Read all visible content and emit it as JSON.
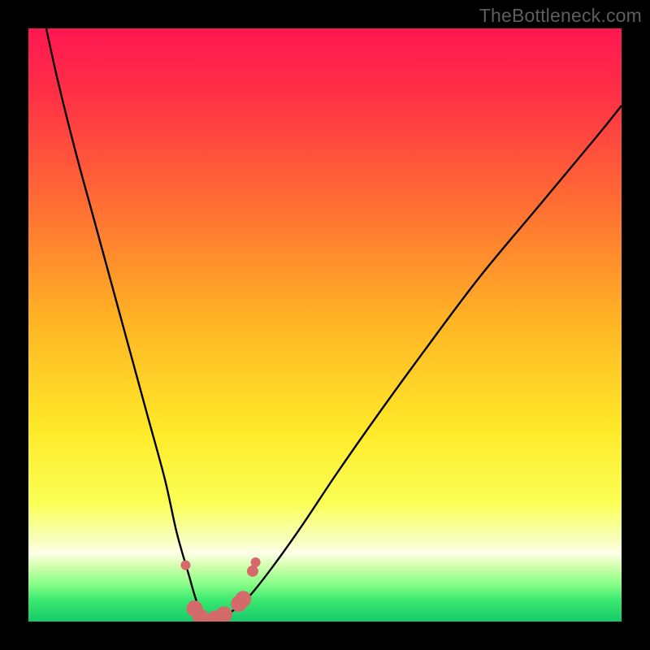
{
  "watermark": "TheBottleneck.com",
  "chart_data": {
    "type": "line",
    "title": "",
    "xlabel": "",
    "ylabel": "",
    "xlim": [
      0,
      100
    ],
    "ylim": [
      0,
      100
    ],
    "note": "Axes are unitless/unlabeled in the image; values below are visually estimated to reproduce the V-shaped bottleneck curve and marker placements.",
    "series": [
      {
        "name": "bottleneck-curve",
        "x": [
          3,
          5,
          8,
          11,
          14,
          17,
          20,
          23,
          25,
          27,
          28.5,
          30,
          32,
          34,
          37,
          41,
          46,
          52,
          59,
          67,
          76,
          86,
          96,
          100
        ],
        "y": [
          100,
          91,
          79,
          68,
          57,
          46,
          35,
          24,
          15,
          8,
          3,
          0.5,
          0.5,
          1.5,
          4,
          9,
          16,
          25,
          35,
          46,
          58,
          70,
          82,
          87
        ]
      }
    ],
    "markers": [
      {
        "x": 26.5,
        "y": 9.5
      },
      {
        "x": 28.0,
        "y": 2.2
      },
      {
        "x": 29.0,
        "y": 0.8
      },
      {
        "x": 31.5,
        "y": 0.5
      },
      {
        "x": 33.0,
        "y": 1.2
      },
      {
        "x": 35.5,
        "y": 3.0
      },
      {
        "x": 36.2,
        "y": 3.8
      },
      {
        "x": 37.8,
        "y": 8.5
      },
      {
        "x": 38.3,
        "y": 10.0
      }
    ],
    "gradient_stops": [
      {
        "offset": 0.0,
        "color": "#ff1751"
      },
      {
        "offset": 0.12,
        "color": "#ff3345"
      },
      {
        "offset": 0.3,
        "color": "#ff6f33"
      },
      {
        "offset": 0.5,
        "color": "#ffb624"
      },
      {
        "offset": 0.68,
        "color": "#ffea2a"
      },
      {
        "offset": 0.8,
        "color": "#faff55"
      },
      {
        "offset": 0.86,
        "color": "#f7ffb8"
      },
      {
        "offset": 0.885,
        "color": "#feffe8"
      },
      {
        "offset": 0.905,
        "color": "#d6ffb0"
      },
      {
        "offset": 0.935,
        "color": "#8cff8a"
      },
      {
        "offset": 0.965,
        "color": "#38e86f"
      },
      {
        "offset": 1.0,
        "color": "#17c96b"
      }
    ],
    "marker_style": {
      "fill": "#d46a6a",
      "radius_small": 6,
      "radius_large": 10
    }
  }
}
